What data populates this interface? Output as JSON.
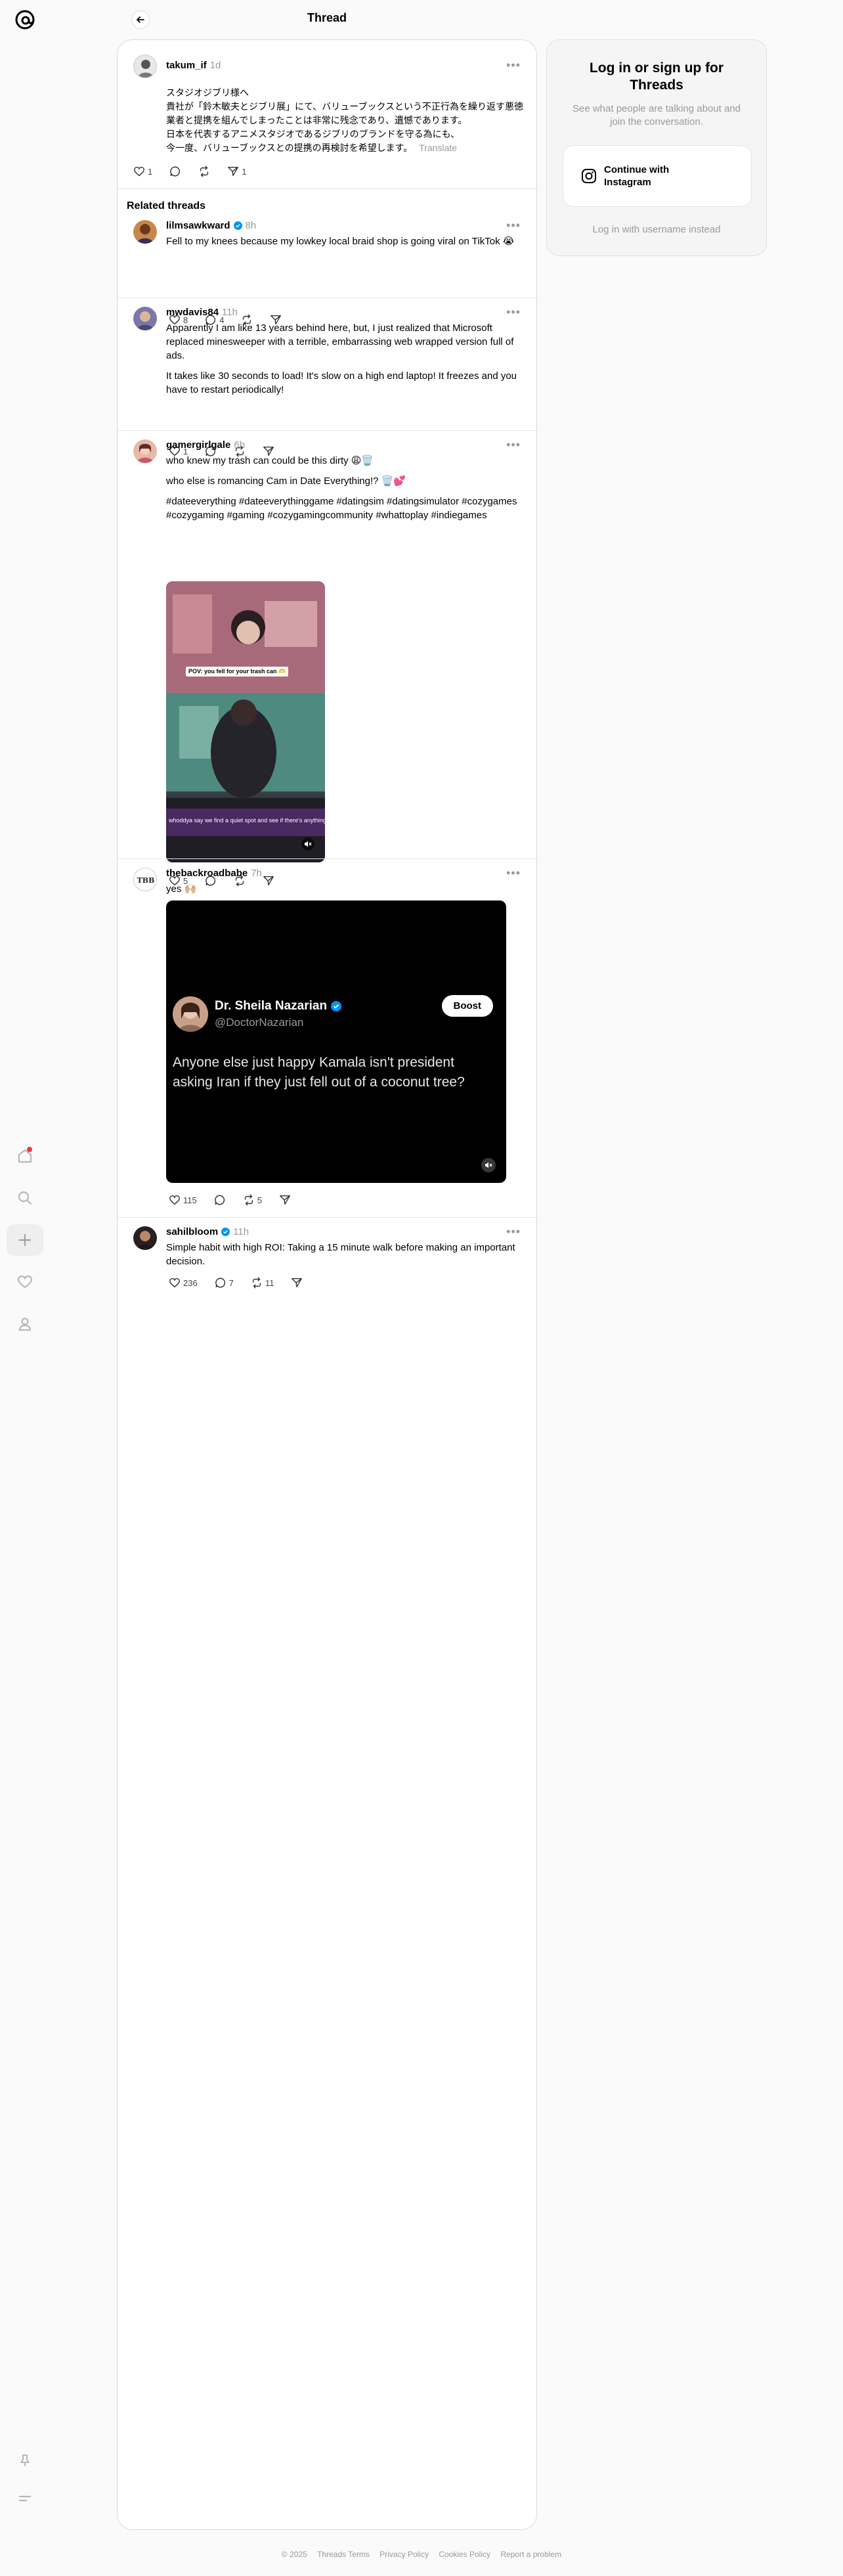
{
  "header": {
    "title": "Thread"
  },
  "main_post": {
    "username": "takum_if",
    "time": "1d",
    "lines": [
      "スタジオジブリ様へ",
      "貴社が「鈴木敏夫とジブリ展」にて、バリューブックスという不正行為を繰り返す悪徳",
      "業者と提携を組んでしまったことは非常に残念であり、遺憾であります。",
      "日本を代表するアニメスタジオであるジブリのブランドを守る為にも、",
      "今一度、バリューブックスとの提携の再検討を希望します。"
    ],
    "translate": "Translate",
    "likes": "1",
    "shares": "1"
  },
  "related_heading": "Related threads",
  "threads": [
    {
      "username": "lilmsawkward",
      "time": "8h",
      "text": [
        "Fell to my knees because my lowkey local braid shop is going viral on TikTok 😭"
      ],
      "likes": "8",
      "replies": "4"
    },
    {
      "username": "mwdavis84",
      "time": "11h",
      "text": [
        "Apparently I am like 13 years behind here, but, I just realized that Microsoft replaced minesweeper with a terrible, embarrassing web wrapped version full of ads.",
        "It takes like 30 seconds to load! It's slow on a high end laptop! It freezes and you have to restart periodically!"
      ],
      "likes": "1"
    },
    {
      "username": "gamergirlgale",
      "time": "6h",
      "text": [
        "who knew my trash can could be this dirty 😩🗑️",
        "who else is romancing Cam in Date Everything!? 🗑️💕",
        "#dateeverything #dateeverythinggame #datingsim #datingsimulator #cozygames #cozygaming #gaming #cozygamingcommunity #whattoplay #indiegames"
      ],
      "photo_caption_top": "POV: you fell for your trash can 🫶",
      "photo_caption_bottom": "whoddya say we find a quiet spot and see if there's anything else fun hidden away in here?",
      "likes": "5"
    },
    {
      "username": "thebackroadbabe",
      "time": "7h",
      "text": [
        "yes 🙌🏼"
      ],
      "video": {
        "name": "Dr. Sheila Nazarian",
        "handle": "@DoctorNazarian",
        "boost": "Boost",
        "quote": "Anyone else just happy Kamala isn't president asking Iran if they just fell out of a coconut tree?"
      },
      "likes": "115",
      "reposts": "5"
    },
    {
      "username": "sahilbloom",
      "time": "11h",
      "text": [
        "Simple habit with high ROI: Taking a 15 minute walk before making an important decision."
      ],
      "likes": "236",
      "replies": "7",
      "reposts": "11"
    }
  ],
  "login": {
    "title": "Log in or sign up for Threads",
    "subtitle": "See what people are talking about and join the conversation.",
    "instagram": "Continue with Instagram",
    "alt": "Log in with username instead"
  },
  "footer": [
    "© 2025",
    "Threads Terms",
    "Privacy Policy",
    "Cookies Policy",
    "Report a problem"
  ],
  "colors": {
    "accent_dot": "#ff3040",
    "verified": "#0095f6"
  }
}
